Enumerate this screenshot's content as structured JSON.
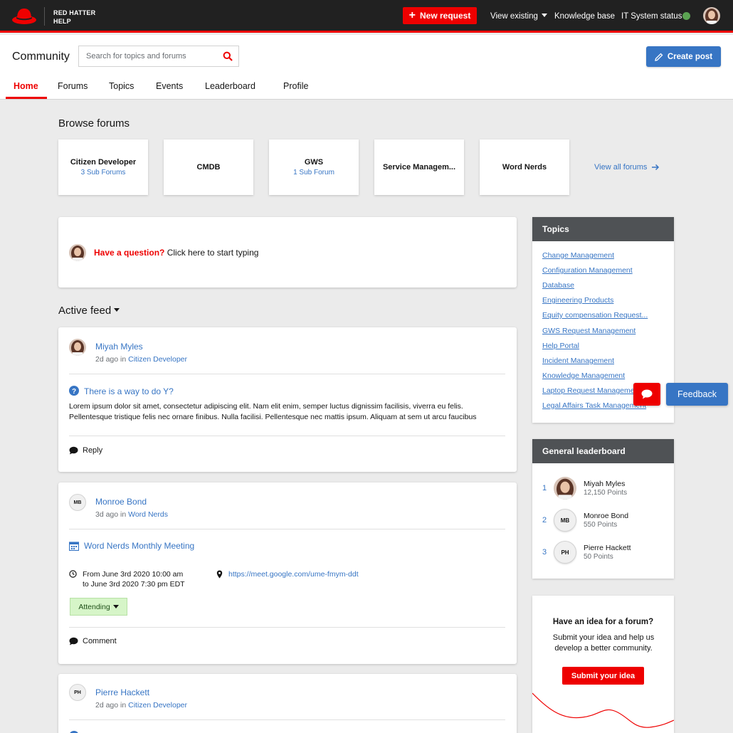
{
  "topbar": {
    "brand_line1": "RED HATTER",
    "brand_line2": "HELP",
    "new_request_label": "New request",
    "view_existing_label": "View existing",
    "knowledge_base_label": "Knowledge base",
    "it_status_label": "IT System status",
    "status_color": "#5ba352",
    "accent_color": "#ee0000"
  },
  "header": {
    "title": "Community",
    "search_placeholder": "Search for topics and forums",
    "search_value": "",
    "create_post_label": "Create post",
    "tabs": [
      {
        "label": "Home",
        "active": true
      },
      {
        "label": "Forums",
        "active": false
      },
      {
        "label": "Topics",
        "active": false
      },
      {
        "label": "Events",
        "active": false
      },
      {
        "label": "Leaderboard",
        "active": false
      },
      {
        "label": "Profile",
        "active": false
      }
    ]
  },
  "browse": {
    "title": "Browse forums",
    "forums": [
      {
        "name": "Citizen Developer",
        "sub": "3 Sub Forums"
      },
      {
        "name": "CMDB",
        "sub": ""
      },
      {
        "name": "GWS",
        "sub": "1 Sub Forum"
      },
      {
        "name": "Service Managem...",
        "sub": ""
      },
      {
        "name": "Word Nerds",
        "sub": ""
      }
    ],
    "view_all_label": "View all forums"
  },
  "ask": {
    "prompt_bold": "Have a question?",
    "prompt_rest": " Click here to start typing"
  },
  "feed": {
    "title": "Active feed",
    "posts": [
      {
        "author": "Miyah Myles",
        "time": "2d ago in ",
        "forum": "Citizen Developer",
        "title": "There is a way to do Y?",
        "body": "Lorem ipsum dolor sit amet, consectetur adipiscing elit. Nam elit enim, semper luctus dignissim facilisis, viverra eu felis. Pellentesque tristique felis nec ornare finibus. Nulla facilisi. Pellentesque nec mattis ipsum. Aliquam at sem ut arcu faucibus",
        "action": "Reply"
      },
      {
        "author": "Monroe Bond",
        "initials": "MB",
        "time": "3d ago in ",
        "forum": "Word Nerds",
        "title": "Word Nerds Monthly Meeting",
        "when_line1": "From June 3rd 2020 10:00 am",
        "when_line2": "to June 3rd 2020 7:30 pm EDT",
        "location": "https://meet.google.com/ume-fmym-ddt",
        "rsvp": "Attending",
        "action": "Comment"
      },
      {
        "author": "Pierre Hackett",
        "initials": "PH",
        "time": "2d ago in ",
        "forum": "Citizen Developer"
      }
    ]
  },
  "topics": {
    "title": "Topics",
    "items": [
      "Change Management",
      "Configuration Management",
      "Database",
      "Engineering Products",
      "Equity compensation Request...",
      "GWS Request Management",
      "Help Portal",
      "Incident Management",
      "Knowledge Management",
      "Laptop Request Management",
      "Legal Affairs Task Management"
    ]
  },
  "leaderboard": {
    "title": "General leaderboard",
    "entries": [
      {
        "rank": "1",
        "name": "Miyah Myles",
        "points": "12,150 Points"
      },
      {
        "rank": "2",
        "name": "Monroe Bond",
        "points": "550 Points",
        "initials": "MB"
      },
      {
        "rank": "3",
        "name": "Pierre Hackett",
        "points": "50 Points",
        "initials": "PH"
      }
    ]
  },
  "idea": {
    "title": "Have an idea for a forum?",
    "description": "Submit your idea and help us develop a better community.",
    "button_label": "Submit your idea"
  },
  "feedback": {
    "label": "Feedback"
  }
}
